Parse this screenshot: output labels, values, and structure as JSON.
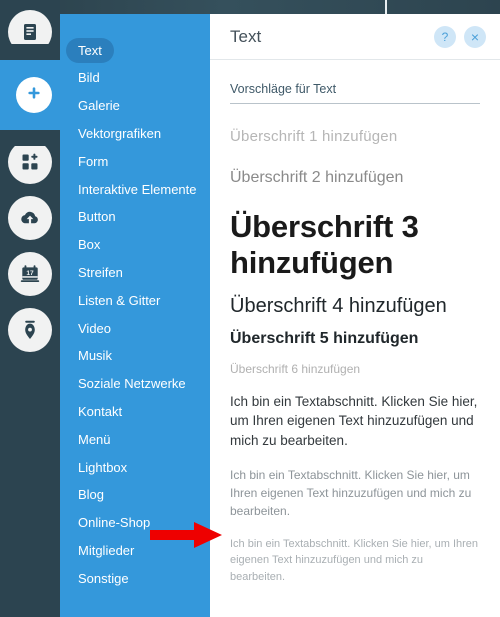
{
  "window": {
    "top_bar_tick": ""
  },
  "icon_rail": {
    "items": [
      {
        "name": "pages-icon",
        "label": "Seiten"
      },
      {
        "name": "add-element-icon",
        "label": "Hinzufügen",
        "active": true
      },
      {
        "name": "apps-add-icon",
        "label": "Apps"
      },
      {
        "name": "cloud-upload-icon",
        "label": "Medien"
      },
      {
        "name": "calendar-icon",
        "label": "Kalender",
        "day": "17"
      },
      {
        "name": "pen-nib-icon",
        "label": "Design"
      }
    ]
  },
  "flyout_menu": {
    "items": [
      {
        "label": "Text",
        "selected": true
      },
      {
        "label": "Bild",
        "selected": false
      },
      {
        "label": "Galerie",
        "selected": false
      },
      {
        "label": "Vektorgrafiken",
        "selected": false
      },
      {
        "label": "Form",
        "selected": false
      },
      {
        "label": "Interaktive Elemente",
        "selected": false
      },
      {
        "label": "Button",
        "selected": false
      },
      {
        "label": "Box",
        "selected": false
      },
      {
        "label": "Streifen",
        "selected": false
      },
      {
        "label": "Listen & Gitter",
        "selected": false
      },
      {
        "label": "Video",
        "selected": false
      },
      {
        "label": "Musik",
        "selected": false
      },
      {
        "label": "Soziale Netzwerke",
        "selected": false
      },
      {
        "label": "Kontakt",
        "selected": false
      },
      {
        "label": "Menü",
        "selected": false
      },
      {
        "label": "Lightbox",
        "selected": false
      },
      {
        "label": "Blog",
        "selected": false
      },
      {
        "label": "Online-Shop",
        "selected": false
      },
      {
        "label": "Mitglieder",
        "selected": false
      },
      {
        "label": "Sonstige",
        "selected": false
      }
    ]
  },
  "panel": {
    "title": "Text",
    "help_label": "?",
    "close_label": "×",
    "tab_label": "Vorschläge für Text",
    "samples": {
      "h1": "Überschrift 1 hinzufügen",
      "h2": "Überschrift 2 hinzufügen",
      "h3": "Überschrift 3 hinzufügen",
      "h4": "Überschrift 4 hinzufügen",
      "h5": "Überschrift 5 hinzufügen",
      "h6": "Überschrift 6 hinzufügen",
      "p1": "Ich bin ein Textabschnitt. Klicken Sie hier, um Ihren eigenen Text hinzuzufügen und mich zu bearbeiten.",
      "p2": "Ich bin ein Textabschnitt. Klicken Sie hier, um Ihren eigenen Text hinzuzufügen und mich zu bearbeiten.",
      "p3": "Ich bin ein Textabschnitt. Klicken Sie hier, um Ihren eigenen Text hinzuzufügen und mich zu bearbeiten."
    }
  },
  "annotation": {
    "arrow": "right-arrow",
    "color": "#ee0000"
  },
  "colors": {
    "rail_dark": "#2c4450",
    "menu_blue": "#3498db",
    "menu_selected_blue": "#2b7fbd",
    "panel_white": "#ffffff",
    "round_btn_bg": "#cfe6f7",
    "round_btn_fg": "#4a9fd8"
  }
}
